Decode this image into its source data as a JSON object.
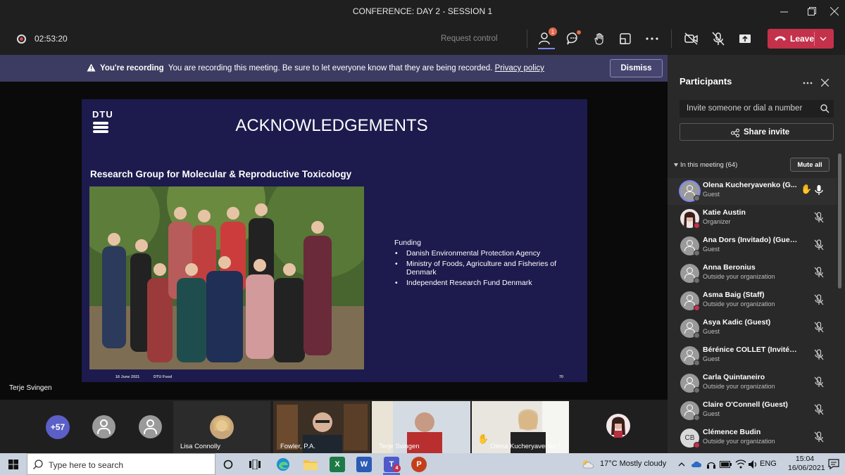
{
  "window": {
    "title": "CONFERENCE: DAY 2 - SESSION 1"
  },
  "toolbar": {
    "timer": "02:53:20",
    "request_control": "Request control",
    "participants_badge": "1",
    "leave_label": "Leave"
  },
  "banner": {
    "bold": "You're recording",
    "text": "You are recording this meeting. Be sure to let everyone know that they are being recorded.",
    "link": "Privacy policy",
    "dismiss": "Dismiss"
  },
  "slide": {
    "logo": "DTU",
    "title": "ACKNOWLEDGEMENTS",
    "subtitle": "Research Group for Molecular & Reproductive Toxicology",
    "funding_heading": "Funding",
    "funding": [
      "Danish Environmental Protection Agency",
      "Ministry of Foods, Agriculture and Fisheries of Denmark",
      "Independent Research Fund Denmark"
    ],
    "footer_date": "16 June 2021",
    "footer_org": "DTU Food",
    "footer_page": "70"
  },
  "stage": {
    "speaker": "Terje Svingen"
  },
  "thumbnails": {
    "more_count": "+57",
    "names": [
      "Lisa Connolly",
      "Fowler, P.A.",
      "Terje Svingen",
      "Olena Kucheryavenko (..."
    ]
  },
  "panel": {
    "title": "Participants",
    "invite_placeholder": "Invite someone or dial a number",
    "share_invite": "Share invite",
    "in_meeting": "In this meeting (64)",
    "mute_all": "Mute all",
    "people": [
      {
        "name": "Olena Kucheryavenko (G...",
        "role": "Guest"
      },
      {
        "name": "Katie Austin",
        "role": "Organizer"
      },
      {
        "name": "Ana Dors (Invitado) (Guest)",
        "role": "Guest"
      },
      {
        "name": "Anna Beronius",
        "role": "Outside your organization"
      },
      {
        "name": "Asma Baig (Staff)",
        "role": "Outside your organization"
      },
      {
        "name": "Asya Kadic (Guest)",
        "role": "Guest"
      },
      {
        "name": "Bérénice COLLET (Invité) (Gue...",
        "role": "Guest"
      },
      {
        "name": "Carla Quintaneiro",
        "role": "Outside your organization"
      },
      {
        "name": "Claire O'Connell (Guest)",
        "role": "Guest"
      },
      {
        "name": "Clémence Budin",
        "role": "Outside your organization",
        "initials": "CB"
      }
    ]
  },
  "taskbar": {
    "search_placeholder": "Type here to search",
    "weather": "17°C  Mostly cloudy",
    "lang": "ENG",
    "time": "15:04",
    "date": "16/06/2021",
    "teams_badge": "4"
  }
}
